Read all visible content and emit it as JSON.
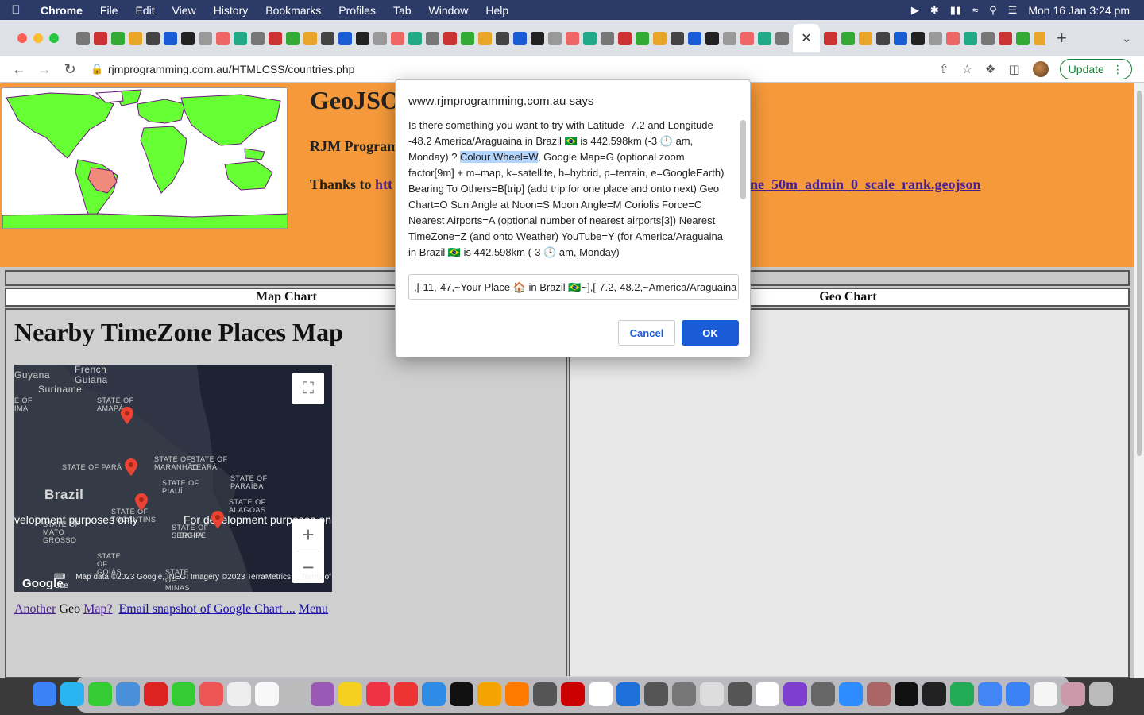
{
  "menubar": {
    "app": "Chrome",
    "items": [
      "File",
      "Edit",
      "View",
      "History",
      "Bookmarks",
      "Profiles",
      "Tab",
      "Window",
      "Help"
    ],
    "clock": "Mon 16 Jan  3:24 pm"
  },
  "browser": {
    "url": "rjmprogramming.com.au/HTMLCSS/countries.php",
    "update_label": "Update"
  },
  "page": {
    "title": "GeoJSO",
    "subtitle": "RJM Program",
    "thanks_prefix": "Thanks to ",
    "thanks_link": "htt",
    "thanks_link2": "ne_50m_admin_0_scale_rank.geojson",
    "map_chart_label": "Map Chart",
    "geo_chart_label": "Geo Chart",
    "nearby_title": "Nearby TimeZone Places Map",
    "links": {
      "another": "Another",
      "geo": "Geo",
      "map": "Map?",
      "email": "Email snapshot of Google Chart ...",
      "menu": "Menu"
    }
  },
  "gmap": {
    "labels": {
      "guyana": "Guyana",
      "french_guiana": "French Guiana",
      "suriname": "Suriname",
      "amapa": "STATE OF AMAPÁ",
      "para": "STATE OF PARÁ",
      "maranhao": "STATE OF MARANHÃO",
      "ceara": "STATE OF CEARÁ",
      "piaui": "STATE OF PIAUÍ",
      "paraiba": "STATE OF PARAÍBA",
      "alagoas": "STATE OF ALAGOAS",
      "brazil": "Brazil",
      "tocantins": "STATE OF TOCANTINS",
      "sergipe": "STATE OF SERGIPE",
      "bahia": "BAHIA",
      "mato_grosso": "STATE OF MATO GROSSO",
      "goias": "STATE OF GOIÁS",
      "minas": "STATE OF MINAS GERAIS",
      "ima": "E OF IMA"
    },
    "dev_left": "velopment purposes only",
    "dev_right": "For development purposes onl",
    "attribution": "Map data ©2023 Google, INEGI Imagery ©2023 TerraMetrics",
    "terms": "Terms of Use",
    "google": "Google"
  },
  "dialog": {
    "title": "www.rjmprogramming.com.au says",
    "body_pre": "  Is there something you want to try with Latitude -7.2 and Longitude -48.2 America/Araguaina in Brazil 🇧🇷 is 442.598km (-3 🕒 am, Monday)  ?  ",
    "body_hl": "Colour Wheel=W",
    "body_post": ",   Google Map=G (optional zoom factor[9m] + m=map, k=satellite, h=hybrid, p=terrain, e=GoogleEarth) Bearing To Others=B[trip] (add trip for one place and onto next) Geo Chart=O Sun Angle at Noon=S Moon Angle=M Coriolis Force=C Nearest Airports=A (optional number of nearest airports[3]) Nearest TimeZone=Z (and onto Weather) YouTube=Y (for America/Araguaina in Brazil 🇧🇷 is 442.598km (-3 🕒 am, Monday)",
    "input_value": ",[-11,-47,~Your Place 🏠 in Brazil 🇧🇷~],[-7.2,-48.2,~America/Araguaina",
    "cancel": "Cancel",
    "ok": "OK"
  },
  "colors": {
    "header_orange": "#f5993a",
    "ok_blue": "#1a5bd6",
    "land_green": "#66ff33",
    "brazil_salmon": "#f08a7a"
  }
}
